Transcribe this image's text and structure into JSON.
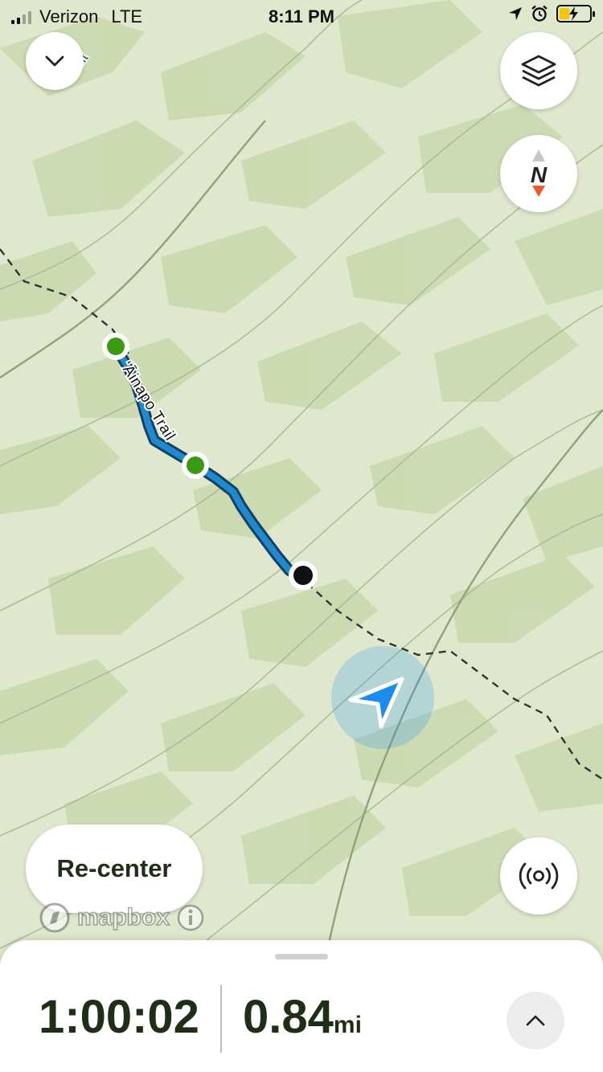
{
  "status_bar": {
    "carrier": "Verizon",
    "network": "LTE",
    "time": "8:11 PM",
    "signal_bars_on": 2,
    "battery_level": 0.3,
    "battery_color": "#f5c400",
    "icons": [
      "location-arrow-icon",
      "alarm-icon",
      "battery-charging-icon"
    ]
  },
  "map": {
    "trail_label": "ʻĀinapo Trail",
    "elevation_fragment": "4ft",
    "colors": {
      "base": "#dfe8cd",
      "terrain": "#c9d8ae",
      "track": "#1f8ad0",
      "waypoint_green": "#3a9a14",
      "location": "#1a8cf0"
    }
  },
  "controls": {
    "collapse_icon": "chevron-down-icon",
    "layers_icon": "layers-icon",
    "compass_letter": "N",
    "compass_icon": "compass-icon",
    "broadcast_icon": "broadcast-icon",
    "recenter_label": "Re-center",
    "attribution": "mapbox",
    "info_icon": "info-icon"
  },
  "stats": {
    "elapsed_time": "1:00:02",
    "distance": "0.84",
    "distance_unit": "mi",
    "expand_icon": "chevron-up-icon"
  }
}
